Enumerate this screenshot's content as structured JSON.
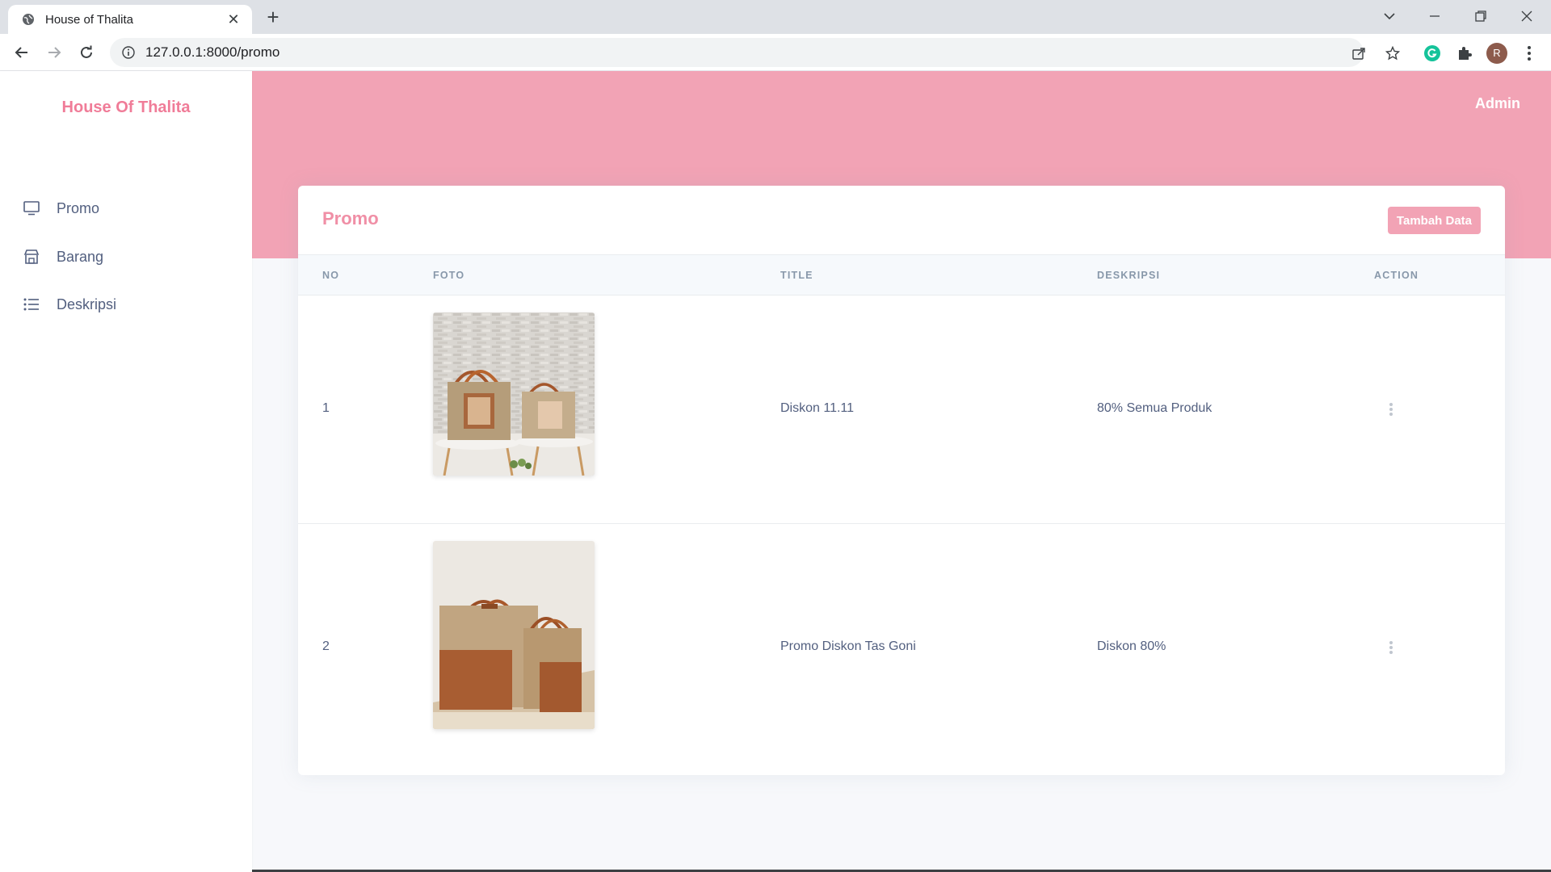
{
  "browser": {
    "tab_title": "House of Thalita",
    "url": "127.0.0.1:8000/promo",
    "profile_initial": "R"
  },
  "sidebar": {
    "brand": "House Of Thalita",
    "items": [
      {
        "label": "Promo",
        "icon": "monitor-icon"
      },
      {
        "label": "Barang",
        "icon": "store-icon"
      },
      {
        "label": "Deskripsi",
        "icon": "list-icon"
      }
    ]
  },
  "header": {
    "user": "Admin"
  },
  "card": {
    "title": "Promo",
    "add_button": "Tambah Data",
    "columns": [
      "NO",
      "FOTO",
      "TITLE",
      "DESKRIPSI",
      "ACTION"
    ],
    "rows": [
      {
        "no": "1",
        "title": "Diskon 11.11",
        "deskripsi": "80% Semua Produk"
      },
      {
        "no": "2",
        "title": "Promo Diskon Tas Goni",
        "deskripsi": "Diskon 80%"
      }
    ]
  },
  "colors": {
    "accent_pink": "#f2a3b5",
    "brand_pink": "#f07c98",
    "text": "#525f7f"
  }
}
